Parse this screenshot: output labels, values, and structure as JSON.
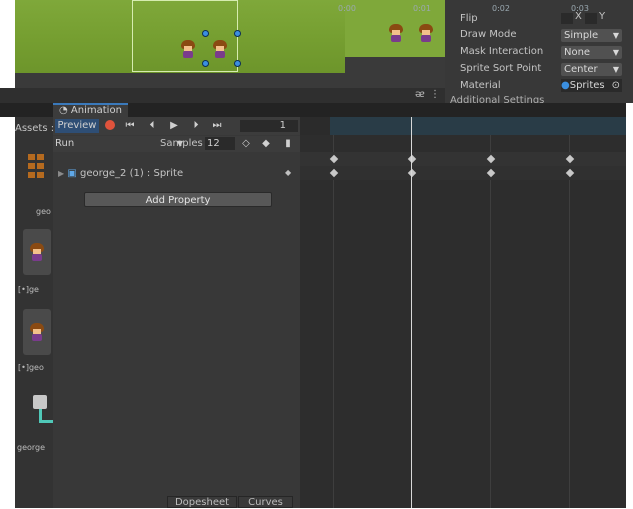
{
  "inspector": {
    "rows": [
      {
        "label": "Flip",
        "value": "",
        "extra": [
          "X",
          "Y"
        ]
      },
      {
        "label": "Draw Mode",
        "value": "Simple"
      },
      {
        "label": "Mask Interaction",
        "value": "None"
      },
      {
        "label": "Sprite Sort Point",
        "value": "Center"
      },
      {
        "label": "Material",
        "value": "Sprites"
      }
    ],
    "cutoff": "Additional Settings"
  },
  "animation": {
    "tab_title": "Animation",
    "preview_label": "Preview",
    "frame_value": "1",
    "clip_name": "Run",
    "samples_label": "Samples",
    "samples_value": "12",
    "property_name": "george_2 (1) : Sprite",
    "add_property_label": "Add Property",
    "dopesheet_label": "Dopesheet",
    "curves_label": "Curves",
    "ruler_labels": [
      "0:00",
      "0:01",
      "0:02",
      "0:03"
    ]
  },
  "project": {
    "assets_label": "Assets :",
    "items": [
      "geo",
      "[•]ge",
      "[•]geo",
      "george"
    ]
  },
  "colors": {
    "accent": "#3a79bb",
    "record": "#e0533c",
    "grass": "#7fa83a",
    "ruler_bg": "#293c47"
  },
  "icons": [
    "play-icon",
    "step-back-icon",
    "step-forward-icon",
    "skip-start-icon",
    "skip-end-icon",
    "record-icon",
    "keyframe-icon",
    "add-event-icon"
  ]
}
